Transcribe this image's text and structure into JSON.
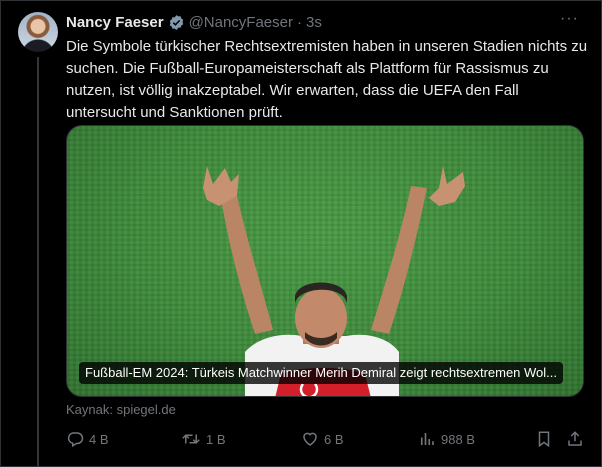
{
  "tweet": {
    "author_name": "Nancy Faeser",
    "handle": "@NancyFaeser",
    "separator": "·",
    "time": "3s",
    "more_label": "···",
    "text": "Die Symbole türkischer Rechtsextremisten haben in unseren Stadien nichts zu suchen. Die Fußball-Europameisterschaft als Plattform für Rassismus zu nutzen, ist völlig inakzeptabel. Wir erwarten, dass die UEFA den Fall untersucht und Sanktionen prüft.",
    "media_caption": "Fußball-EM 2024: Türkeis Matchwinner Merih Demiral zeigt rechtsextremen Wol...",
    "source": "Kaynak: spiegel.de"
  },
  "actions": {
    "replies": "4 B",
    "retweets": "1 B",
    "likes": "6 B",
    "views": "988 B"
  },
  "icons": {
    "verified": "verified-badge-icon",
    "reply": "reply-icon",
    "retweet": "retweet-icon",
    "like": "heart-icon",
    "views": "views-icon",
    "bookmark": "bookmark-icon",
    "share": "share-icon"
  },
  "colors": {
    "background": "#000000",
    "text": "#e7e9ea",
    "muted": "#71767b",
    "verified": "#829aab",
    "pitch": "#3d8a3a"
  }
}
